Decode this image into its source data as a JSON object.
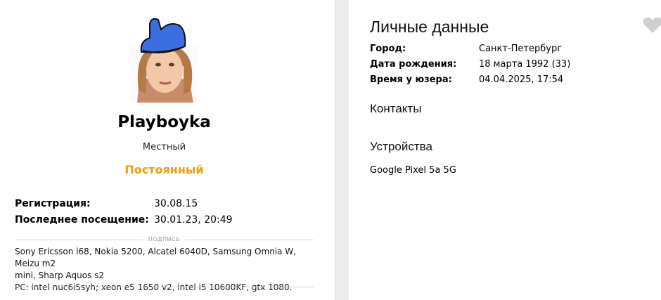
{
  "profile": {
    "username": "Playboyka",
    "title": "Местный",
    "status": "Постоянный",
    "status_color": "#f29c11",
    "stats": [
      {
        "label": "Регистрация:",
        "value": "30.08.15"
      },
      {
        "label": "Последнее посещение:",
        "value": "30.01.23, 20:49"
      }
    ],
    "signature_title": "ПОДПИСЬ",
    "signature_lines": [
      "Sony Ericsson i68, Nokia 5200, Alcatel 6040D, Samsung Omnia W, Meizu m2",
      "mini, Sharp Aquos s2",
      "PC: intel nuc6i5syh; xeon e5 1650 v2, intel i5 10600KF, gtx 1080."
    ]
  },
  "personal": {
    "heading": "Личные данные",
    "fields": [
      {
        "label": "Город:",
        "value": "Санкт-Петербург"
      },
      {
        "label": "Дата рождения:",
        "value": "18 марта 1992 (33)"
      },
      {
        "label": "Время у юзера:",
        "value": "04.04.2025, 17:54"
      }
    ],
    "contacts_heading": "Контакты",
    "devices_heading": "Устройства",
    "device": "Google Pixel 5a 5G"
  },
  "icons": {
    "avatar": "avatar-with-blue-hat",
    "like": "heart-icon"
  }
}
